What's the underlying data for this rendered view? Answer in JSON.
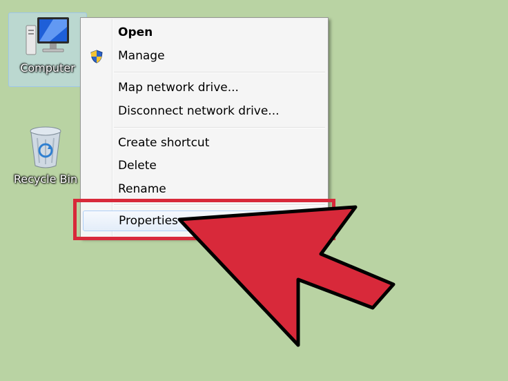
{
  "desktop": {
    "background_color": "#b9d3a3",
    "icons": [
      {
        "label": "Computer",
        "icon": "computer-icon",
        "selected": true
      },
      {
        "label": "Recycle Bin",
        "icon": "recycle-bin-icon",
        "selected": false
      }
    ]
  },
  "context_menu": {
    "items": [
      {
        "label": "Open",
        "bold": true
      },
      {
        "label": "Manage",
        "icon": "uac-shield-icon"
      },
      {
        "label": "Map network drive..."
      },
      {
        "label": "Disconnect network drive..."
      },
      {
        "label": "Create shortcut"
      },
      {
        "label": "Delete"
      },
      {
        "label": "Rename"
      },
      {
        "label": "Properties",
        "highlighted": true
      }
    ]
  },
  "annotation": {
    "highlight_color": "#d8293a",
    "arrow_color": "#d8293a",
    "points_to": "Properties"
  }
}
